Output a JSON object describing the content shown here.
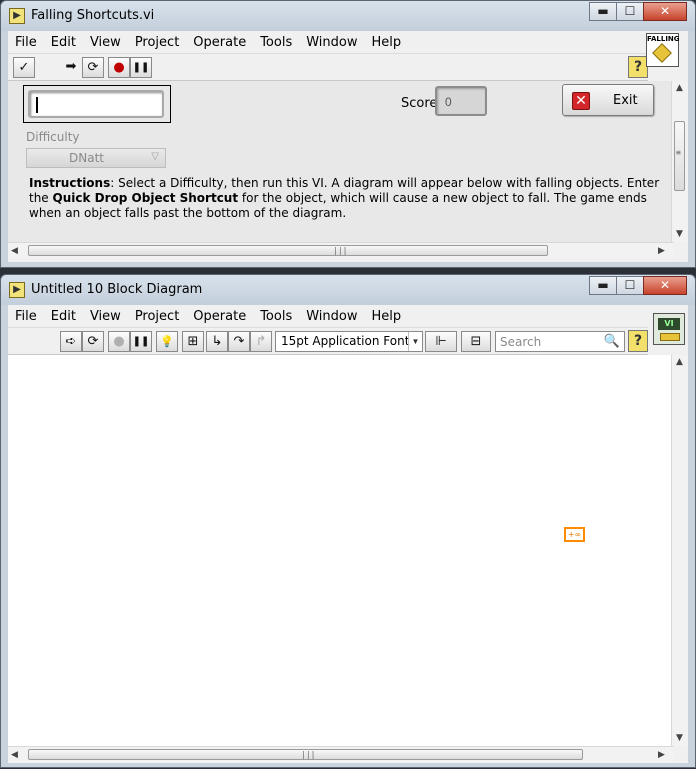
{
  "front_panel": {
    "title": "Falling Shortcuts.vi",
    "title_icon": "vi-icon",
    "window_buttons": {
      "minimize": "▬",
      "maximize": "☐",
      "close": "✕"
    },
    "menu": [
      "File",
      "Edit",
      "View",
      "Project",
      "Operate",
      "Tools",
      "Window",
      "Help"
    ],
    "toolbar": {
      "run_check": "✓",
      "run_arrow": "➡",
      "run_continuous": "⟳",
      "abort": "●",
      "pause": "❚❚",
      "help": "?"
    },
    "vi_icon_caption": "FALLING",
    "input_value": "",
    "score": {
      "label": "Score",
      "value": "0"
    },
    "exit": {
      "icon": "✕",
      "label": "Exit"
    },
    "difficulty": {
      "label": "Difficulty",
      "value": "DNatt",
      "arrow": "▽"
    },
    "instructions": {
      "lead": "Instructions",
      "part1": ": Select a Difficulty, then run this VI. A diagram will appear below with falling objects. Enter the ",
      "bold1": "Quick Drop Object Shortcut",
      "part2": " for the object, which will cause a new object to fall. The game ends when an object falls past the bottom of the diagram."
    },
    "scroll": {
      "up": "▲",
      "down": "▼",
      "left": "◀",
      "right": "▶",
      "grip_h": "|||",
      "grip_v": "≡"
    }
  },
  "block_diagram": {
    "title": "Untitled 10 Block Diagram",
    "title_icon": "vi-icon",
    "window_buttons": {
      "minimize": "▬",
      "maximize": "☐",
      "close": "✕"
    },
    "menu": [
      "File",
      "Edit",
      "View",
      "Project",
      "Operate",
      "Tools",
      "Window",
      "Help"
    ],
    "toolbar": {
      "run_arrow": "➪",
      "run_continuous": "⟳",
      "abort": "●",
      "pause": "❚❚",
      "highlight": "💡",
      "retain": "⊞",
      "step_into": "↳",
      "step_over": "↷",
      "step_out": "↱",
      "font": "15pt Application Font",
      "align": "⊩",
      "distribute": "⊟",
      "search_placeholder": "Search",
      "search_icon": "🔍",
      "help": "?"
    },
    "vi_icon_caption": "VI",
    "diagram_node": "+∞",
    "scroll": {
      "up": "▲",
      "down": "▼",
      "left": "◀",
      "right": "▶",
      "grip_h": "|||"
    }
  },
  "colors": {
    "node_border": "#ff8c00",
    "exit_icon": "#d3262a",
    "abort": "#c00000"
  }
}
